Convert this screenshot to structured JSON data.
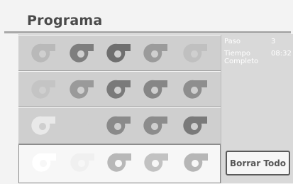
{
  "header": {
    "title": "Programa"
  },
  "info": {
    "paso_label": "Paso",
    "paso_value": "3",
    "tiempo_label_1": "Tiempo",
    "tiempo_label_2": "Completo",
    "tiempo_value": "08:32"
  },
  "actions": {
    "clear_all_label": "Borrar Todo"
  },
  "program": {
    "rows": 4,
    "cols": 5,
    "selected_row": 4
  }
}
